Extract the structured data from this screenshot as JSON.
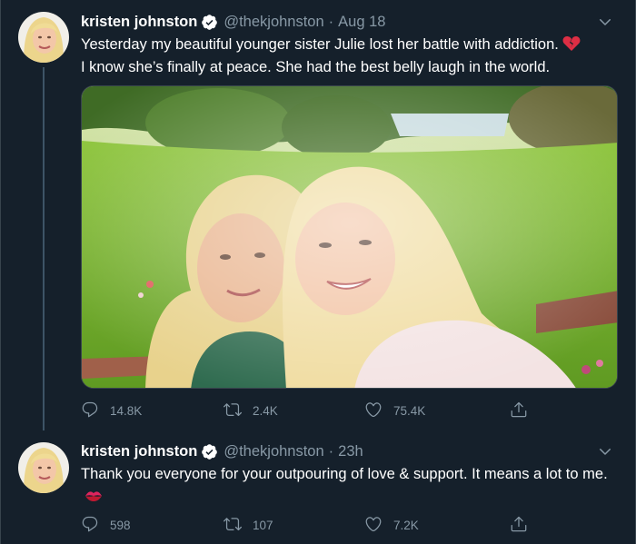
{
  "tweets": [
    {
      "display_name": "kristen johnston",
      "handle": "@thekjohnston",
      "separator": "·",
      "timestamp": "Aug 18",
      "text_line1": "Yesterday my beautiful younger sister Julie lost her battle with addiction.",
      "text_line2": "I know she’s finally at peace. She had the best belly laugh in the world.",
      "emoji": "broken-heart-icon",
      "has_photo": true,
      "reply_count": "14.8K",
      "retweet_count": "2.4K",
      "like_count": "75.4K"
    },
    {
      "display_name": "kristen johnston",
      "handle": "@thekjohnston",
      "separator": "·",
      "timestamp": "23h",
      "text_line1": "Thank you everyone for your outpouring of love & support. It means a lot to me.",
      "emoji": "kiss-mark-icon",
      "has_photo": false,
      "reply_count": "598",
      "retweet_count": "107",
      "like_count": "7.2K"
    }
  ],
  "icons": {
    "reply": "reply-icon",
    "retweet": "retweet-icon",
    "like": "heart-icon",
    "share": "share-icon",
    "verified": "verified-badge-icon",
    "caret": "chevron-down-icon"
  },
  "colors": {
    "background": "#15202b",
    "text_primary": "#ffffff",
    "text_secondary": "#8899a6",
    "border": "#38444d",
    "thread_line": "#3d5466"
  }
}
